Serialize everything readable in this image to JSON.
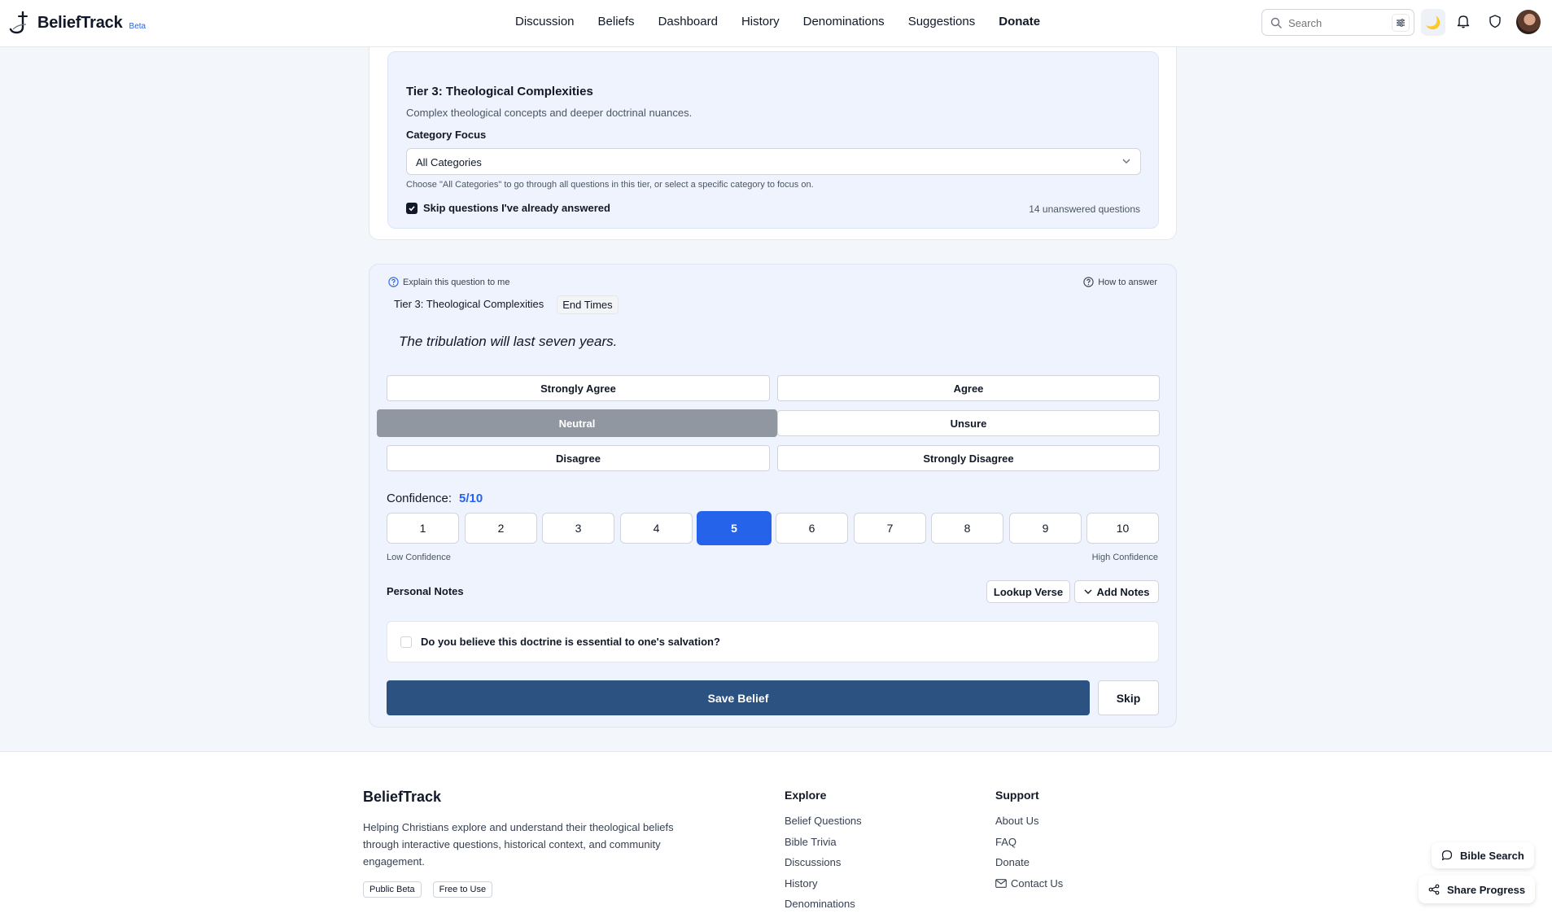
{
  "header": {
    "logo_text": "BeliefTrack",
    "beta": "Beta",
    "nav": [
      "Discussion",
      "Beliefs",
      "Dashboard",
      "History",
      "Denominations",
      "Suggestions",
      "Donate"
    ],
    "search_placeholder": "Search",
    "theme_icon": "moon-icon"
  },
  "filters": {
    "tier_title": "Tier 3: Theological Complexities",
    "tier_desc": "Complex theological concepts and deeper doctrinal nuances.",
    "category_label": "Category Focus",
    "category_value": "All Categories",
    "category_hint": "Choose \"All Categories\" to go through all questions in this tier, or select a specific category to focus on.",
    "skip_answered_label": "Skip questions I've already answered",
    "skip_answered_checked": true,
    "unanswered": "14 unanswered questions"
  },
  "question": {
    "explain": "Explain this question to me",
    "how_to": "How to answer",
    "tier_tag": "Tier 3: Theological Complexities",
    "category_tag": "End Times",
    "statement": "The tribulation will last seven years.",
    "options": [
      "Strongly Agree",
      "Agree",
      "Neutral",
      "Unsure",
      "Disagree",
      "Strongly Disagree"
    ],
    "selected_option": "Neutral",
    "confidence_label": "Confidence:",
    "confidence_value": "5/10",
    "confidence_scale": [
      "1",
      "2",
      "3",
      "4",
      "5",
      "6",
      "7",
      "8",
      "9",
      "10"
    ],
    "confidence_selected": 5,
    "low_label": "Low Confidence",
    "high_label": "High Confidence",
    "notes_label": "Personal Notes",
    "lookup_verse": "Lookup Verse",
    "add_notes": "Add Notes",
    "essential_question": "Do you believe this doctrine is essential to one's salvation?",
    "save": "Save Belief",
    "skip": "Skip"
  },
  "footer": {
    "brand": "BeliefTrack",
    "description": "Helping Christians explore and understand their theological beliefs through interactive questions, historical context, and community engagement.",
    "badges": [
      "Public Beta",
      "Free to Use"
    ],
    "explore_title": "Explore",
    "explore_links": [
      "Belief Questions",
      "Bible Trivia",
      "Discussions",
      "History",
      "Denominations"
    ],
    "support_title": "Support",
    "support_links": [
      "About Us",
      "FAQ",
      "Donate",
      "Contact Us"
    ]
  },
  "floating": {
    "bible_search": "Bible Search",
    "share_progress": "Share Progress"
  },
  "colors": {
    "accent": "#2563eb",
    "save_button": "#2c5282",
    "selected_option": "#9197a1",
    "panel_bg": "#eef3fd"
  }
}
